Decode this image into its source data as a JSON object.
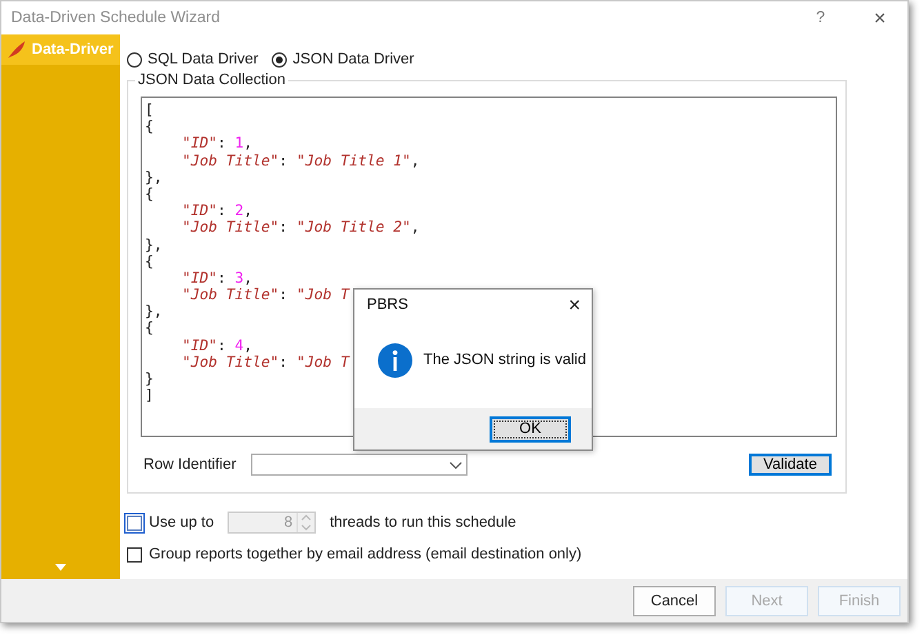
{
  "window": {
    "title": "Data-Driven Schedule Wizard",
    "help": "?",
    "close": "×"
  },
  "sidebar": {
    "items": [
      {
        "label": "Data-Driver",
        "selected": true
      }
    ]
  },
  "driver_options": [
    {
      "label": "SQL Data Driver",
      "selected": false
    },
    {
      "label": "JSON Data Driver",
      "selected": true
    }
  ],
  "json_group": {
    "title": "JSON Data Collection",
    "lines": [
      {
        "indent": false,
        "tokens": [
          {
            "kind": "punct",
            "text": "["
          }
        ]
      },
      {
        "indent": false,
        "tokens": [
          {
            "kind": "punct",
            "text": "{"
          }
        ]
      },
      {
        "indent": true,
        "tokens": [
          {
            "kind": "string",
            "text": "\"ID\""
          },
          {
            "kind": "punct",
            "text": ": "
          },
          {
            "kind": "number",
            "text": "1"
          },
          {
            "kind": "punct",
            "text": ","
          }
        ]
      },
      {
        "indent": true,
        "tokens": [
          {
            "kind": "string",
            "text": "\"Job Title\""
          },
          {
            "kind": "punct",
            "text": ": "
          },
          {
            "kind": "string",
            "text": "\"Job Title 1\""
          },
          {
            "kind": "punct",
            "text": ","
          }
        ]
      },
      {
        "indent": false,
        "tokens": [
          {
            "kind": "punct",
            "text": "},"
          }
        ]
      },
      {
        "indent": false,
        "tokens": [
          {
            "kind": "punct",
            "text": "{"
          }
        ]
      },
      {
        "indent": true,
        "tokens": [
          {
            "kind": "string",
            "text": "\"ID\""
          },
          {
            "kind": "punct",
            "text": ": "
          },
          {
            "kind": "number",
            "text": "2"
          },
          {
            "kind": "punct",
            "text": ","
          }
        ]
      },
      {
        "indent": true,
        "tokens": [
          {
            "kind": "string",
            "text": "\"Job Title\""
          },
          {
            "kind": "punct",
            "text": ": "
          },
          {
            "kind": "string",
            "text": "\"Job Title 2\""
          },
          {
            "kind": "punct",
            "text": ","
          }
        ]
      },
      {
        "indent": false,
        "tokens": [
          {
            "kind": "punct",
            "text": "},"
          }
        ]
      },
      {
        "indent": false,
        "tokens": [
          {
            "kind": "punct",
            "text": "{"
          }
        ]
      },
      {
        "indent": true,
        "tokens": [
          {
            "kind": "string",
            "text": "\"ID\""
          },
          {
            "kind": "punct",
            "text": ": "
          },
          {
            "kind": "number",
            "text": "3"
          },
          {
            "kind": "punct",
            "text": ","
          }
        ]
      },
      {
        "indent": true,
        "tokens": [
          {
            "kind": "string",
            "text": "\"Job Title\""
          },
          {
            "kind": "punct",
            "text": ": "
          },
          {
            "kind": "string",
            "text": "\"Job T"
          }
        ]
      },
      {
        "indent": false,
        "tokens": [
          {
            "kind": "punct",
            "text": "},"
          }
        ]
      },
      {
        "indent": false,
        "tokens": [
          {
            "kind": "punct",
            "text": "{"
          }
        ]
      },
      {
        "indent": true,
        "tokens": [
          {
            "kind": "string",
            "text": "\"ID\""
          },
          {
            "kind": "punct",
            "text": ": "
          },
          {
            "kind": "number",
            "text": "4"
          },
          {
            "kind": "punct",
            "text": ","
          }
        ]
      },
      {
        "indent": true,
        "tokens": [
          {
            "kind": "string",
            "text": "\"Job Title\""
          },
          {
            "kind": "punct",
            "text": ": "
          },
          {
            "kind": "string",
            "text": "\"Job T"
          }
        ]
      },
      {
        "indent": false,
        "tokens": [
          {
            "kind": "punct",
            "text": "}"
          }
        ]
      },
      {
        "indent": false,
        "tokens": [
          {
            "kind": "punct",
            "text": "]"
          }
        ]
      }
    ],
    "row_identifier_label": "Row Identifier",
    "validate_button": "Validate"
  },
  "options": [
    {
      "kind": "threads",
      "label": "Use up to",
      "checked": false,
      "focused": true,
      "spin_value": "8",
      "suffix": "threads to run this schedule"
    },
    {
      "kind": "plain",
      "label": "Group reports together by email address (email destination only)",
      "checked": false,
      "focused": false
    }
  ],
  "footer_buttons": [
    {
      "label": "Cancel",
      "disabled": false
    },
    {
      "label": "Next",
      "disabled": true
    },
    {
      "label": "Finish",
      "disabled": true
    }
  ],
  "dialog": {
    "title": "PBRS",
    "close": "×",
    "message": "The JSON string is valid",
    "button": "OK"
  }
}
